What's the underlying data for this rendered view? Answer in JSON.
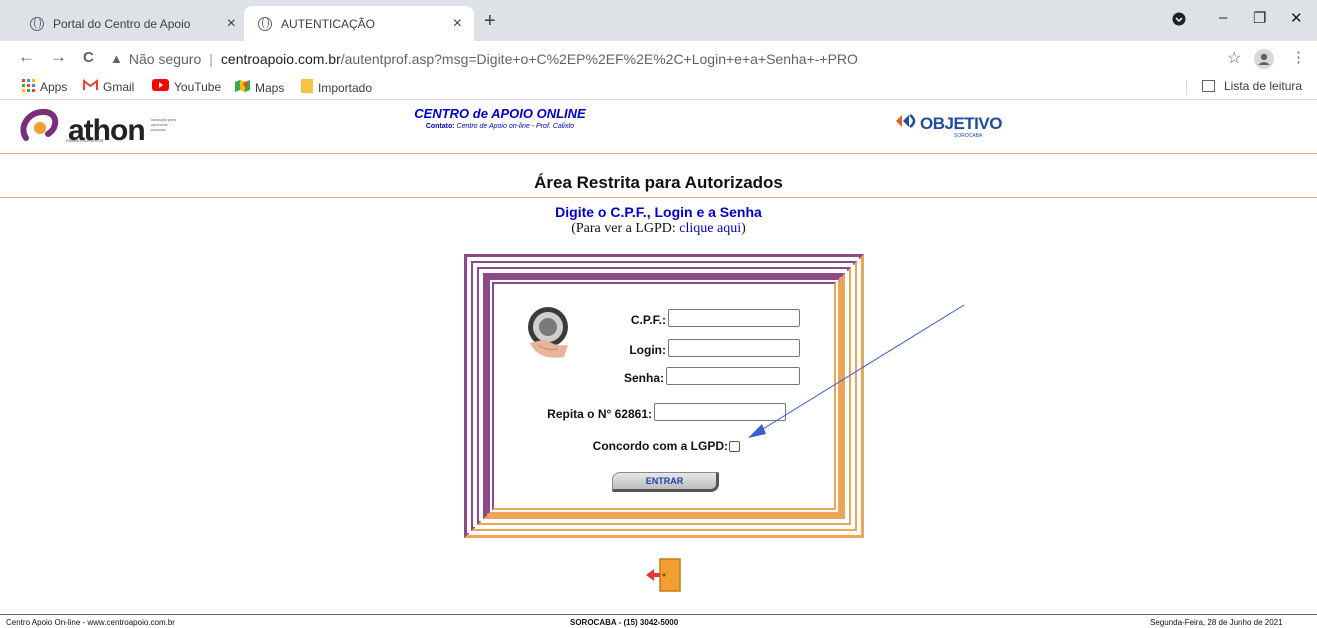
{
  "browser": {
    "tabs": [
      {
        "title": "Portal do Centro de Apoio"
      },
      {
        "title": "AUTENTICAÇÃO"
      }
    ],
    "tab_close": "×",
    "new_tab": "+",
    "window": {
      "minimize": "–",
      "restore": "❐",
      "close": "✕"
    },
    "nav": {
      "back": "←",
      "forward": "→",
      "reload": "C"
    },
    "address": {
      "warning_icon": "▲",
      "security_label": "Não seguro",
      "separator": "|",
      "domain": "centroapoio.com.br",
      "path": "/autentprof.asp?msg=Digite+o+C%2EP%2EF%2E%2C+Login+e+a+Senha+-+PRO"
    },
    "star": "☆",
    "menu": "⋮",
    "bookmarks": [
      {
        "label": "Apps",
        "icon": "apps-grid-icon"
      },
      {
        "label": "Gmail",
        "icon": "gmail-icon"
      },
      {
        "label": "YouTube",
        "icon": "youtube-icon"
      },
      {
        "label": "Maps",
        "icon": "maps-icon"
      },
      {
        "label": "Importado",
        "icon": "folder-icon"
      }
    ],
    "reading_list": "Lista de leitura"
  },
  "header": {
    "athon_logo": {
      "text": "athon",
      "tagline": "Inovação para aprimorar pessoas.",
      "sub": "ENSINO SUPERIOR"
    },
    "title": "CENTRO de APOIO ONLINE",
    "contact_label": "Contato:",
    "contact_text": "Centro de Apoio on-line - Prof. Calixto",
    "objetivo_logo": {
      "text": "OBJETIVO",
      "sub": "SOROCABA"
    }
  },
  "main": {
    "title": "Área Restrita para Autorizados",
    "subtitle": "Digite o C.P.F., Login e a Senha",
    "lgpd_prefix": "(Para ver a LGPD: ",
    "lgpd_link": "clique aqui",
    "lgpd_suffix": ")"
  },
  "form": {
    "cpf_label": "C.P.F.:",
    "login_label": "Login:",
    "senha_label": "Senha:",
    "repeat_label": "Repita o N° 62861:",
    "agree_label": "Concordo com a LGPD:",
    "submit_label": "ENTRAR"
  },
  "colors": {
    "purple": "#8c4a8a",
    "orange": "#eba65c",
    "accent_blue": "#0000cc",
    "arrow": "#3a5fc8"
  },
  "footer": {
    "left": "Centro Apoio On-line - www.centroapoio.com.br",
    "center": "SOROCABA - (15) 3042-5000",
    "right": "Segunda-Feira, 28 de Junho de 2021"
  }
}
